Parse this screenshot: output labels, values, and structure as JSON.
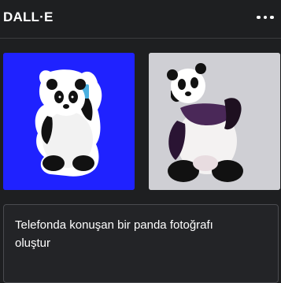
{
  "header": {
    "title": "DALL·E",
    "menu_icon": "more-horizontal-icon"
  },
  "results": [
    {
      "background": "#1f22ff"
    },
    {
      "background": "#cfcfd4"
    }
  ],
  "prompt": {
    "text": "Telefonda konuşan bir panda fotoğrafı oluştur"
  }
}
